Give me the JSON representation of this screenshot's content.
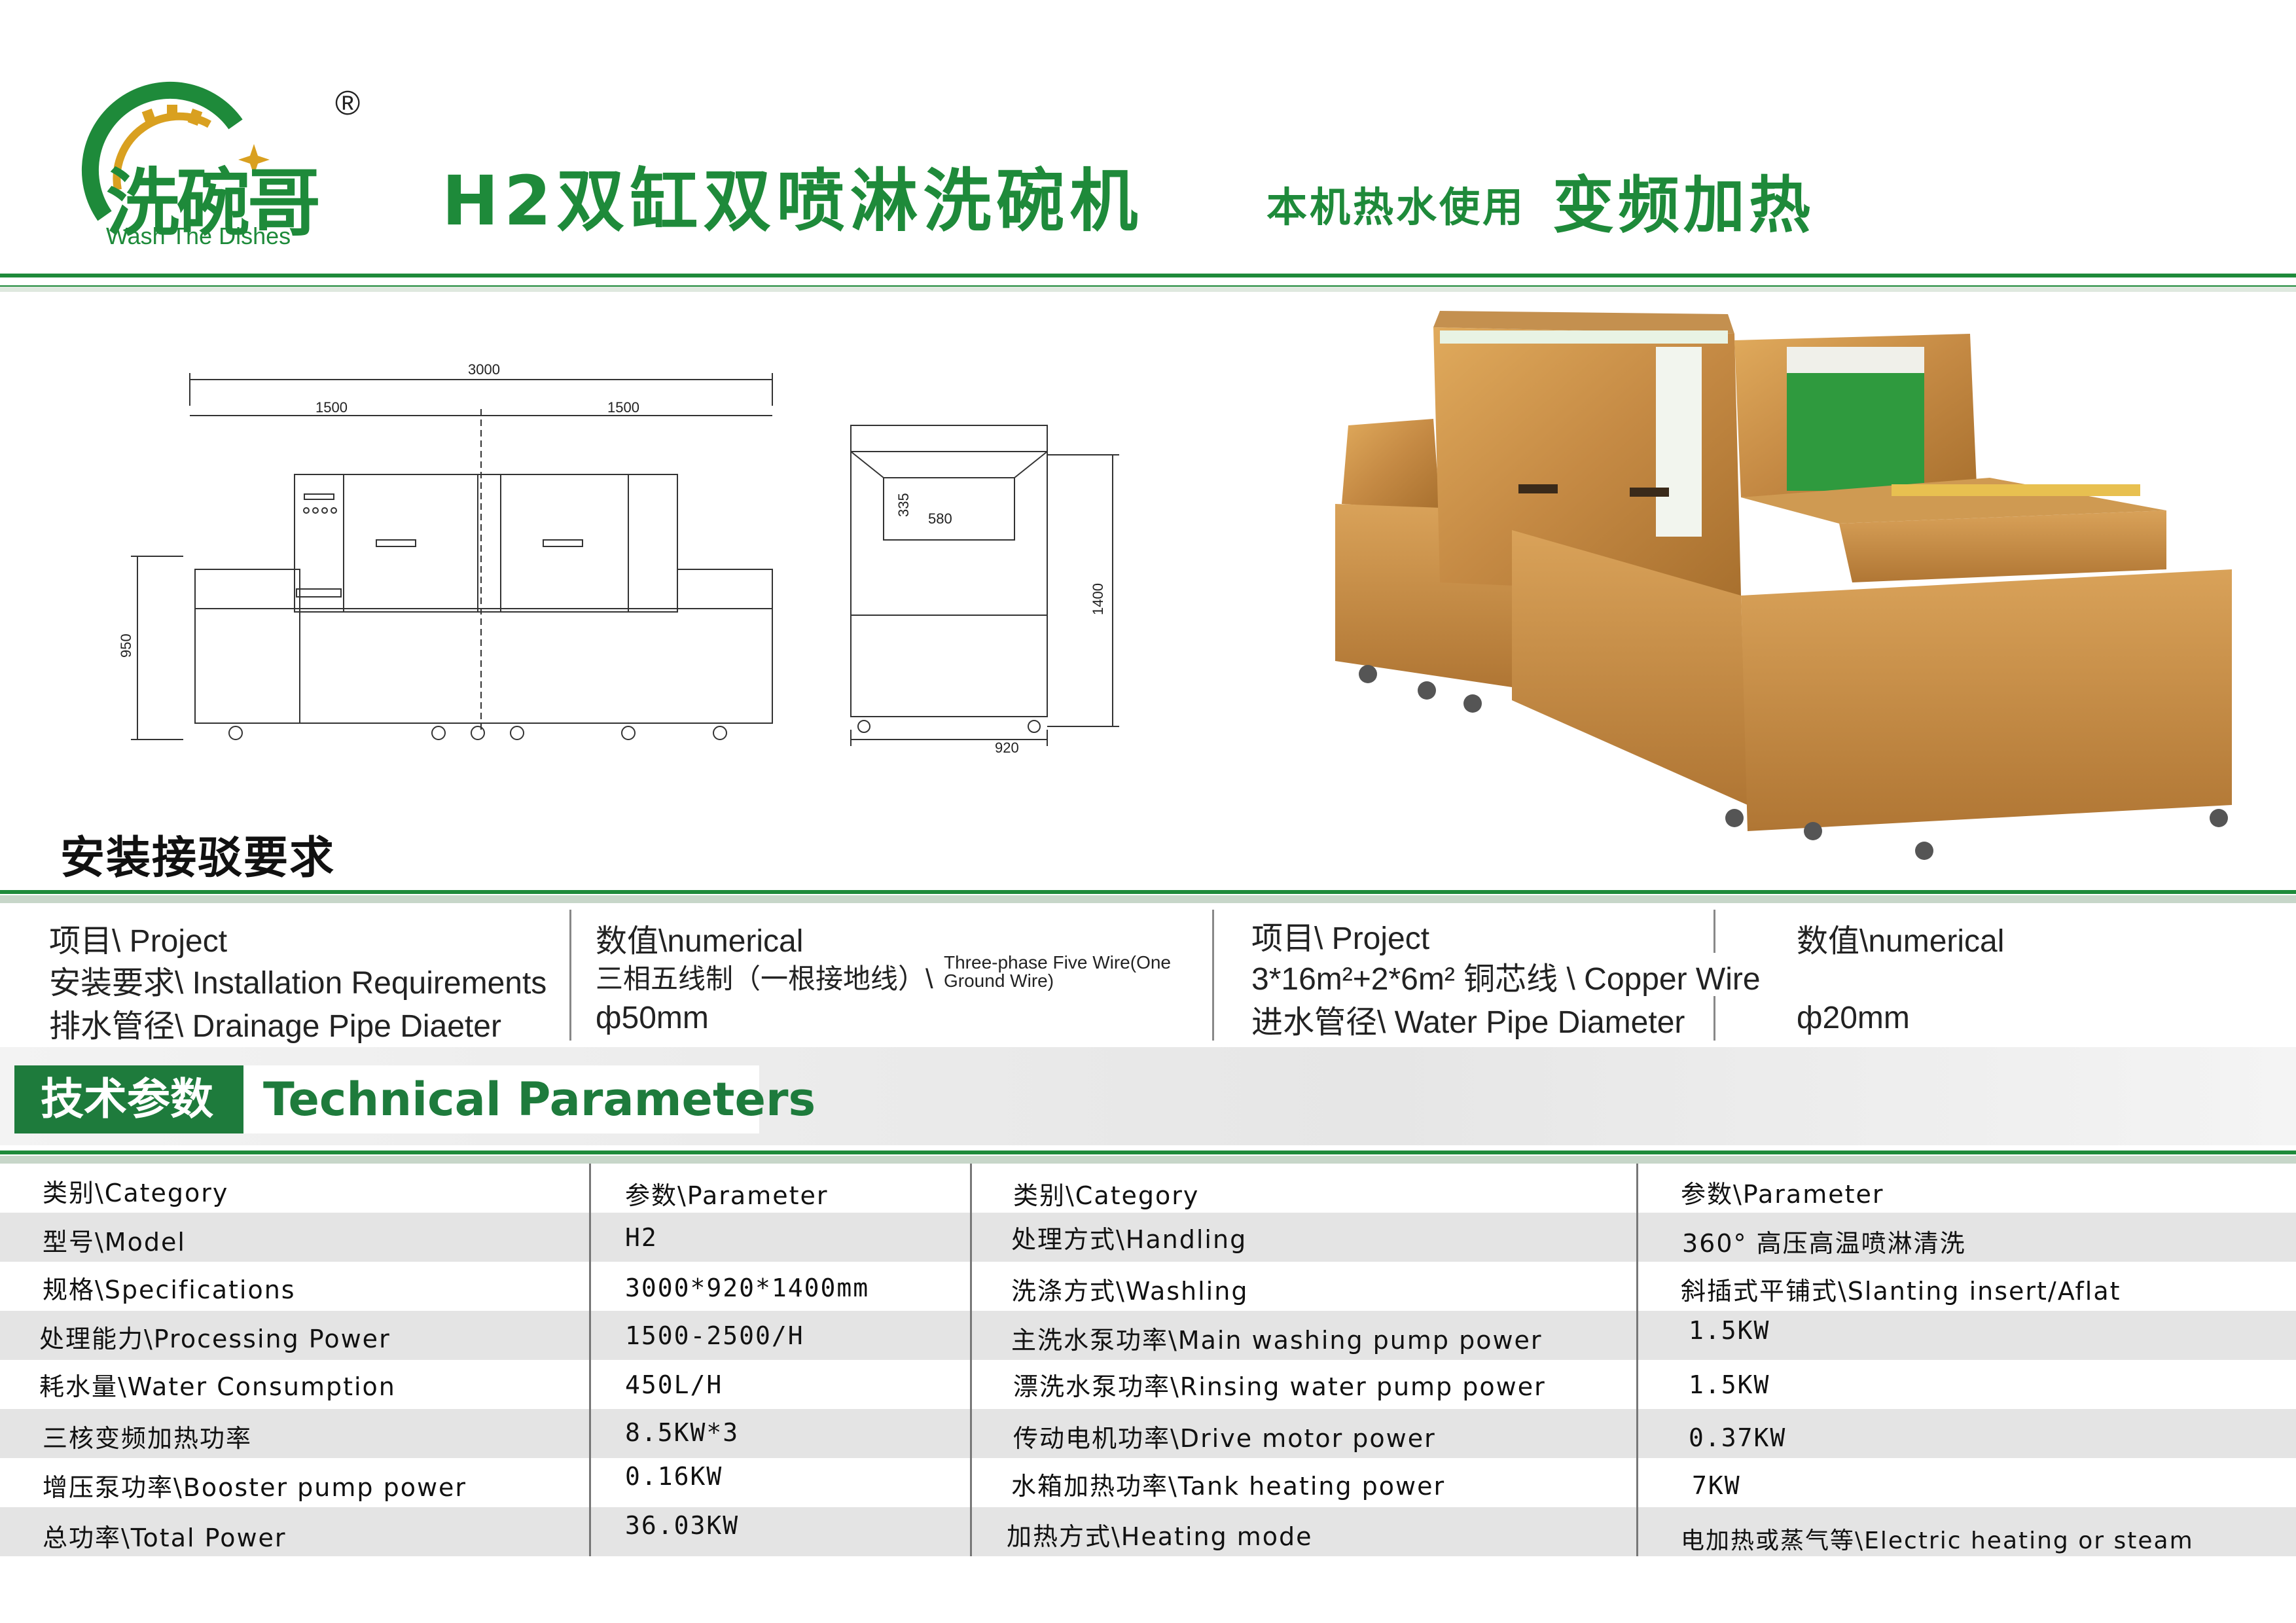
{
  "brand": {
    "logo_cn": "洗碗哥",
    "logo_en": "Wash The Dishes",
    "registered": "®"
  },
  "title": {
    "main": "H2双缸双喷淋洗碗机",
    "small": "本机热水使用",
    "big2": "变频加热"
  },
  "drawing": {
    "total_width": "3000",
    "left_width": "1500",
    "right_width": "1500",
    "height": "950",
    "side_height": "1400",
    "side_depth": "920",
    "opening_height": "335",
    "opening_width": "580"
  },
  "install": {
    "title": "安装接驳要求",
    "header": {
      "left_project": "项目\\ Project",
      "left_value": "数值\\numerical",
      "right_project": "项目\\ Project",
      "right_value": "数值\\numerical"
    },
    "rows": [
      {
        "left_project": "安装要求\\ Installation Requirements",
        "left_value": "三相五线制（一根接地线）\\",
        "left_value_small_1": "Three-phase Five Wire(One",
        "left_value_small_2": "Ground Wire)",
        "right_project": "3*16m²+2*6m² 铜芯线 \\ Copper Wire",
        "right_value": ""
      },
      {
        "left_project": "排水管径\\ Drainage Pipe Diaeter",
        "left_value": "ф50mm",
        "right_project": "进水管径\\ Water Pipe Diameter",
        "right_value": "ф20mm"
      }
    ]
  },
  "tech": {
    "title_cn": "技术参数",
    "title_en": "Technical Parameters",
    "header": {
      "c1": "类别\\Category",
      "c2": "参数\\Parameter",
      "c3": "类别\\Category",
      "c4": "参数\\Parameter"
    },
    "rows": [
      {
        "c1": "型号\\Model",
        "c2": "H2",
        "c3": "处理方式\\Handling",
        "c4": "360° 高压高温喷淋清洗"
      },
      {
        "c1": "规格\\Specifications",
        "c2": "3000*920*1400mm",
        "c3": "洗涤方式\\Washling",
        "c4": "斜插式平铺式\\Slanting insert/Aflat"
      },
      {
        "c1": "处理能力\\Processing Power",
        "c2": "1500-2500/H",
        "c3": "主洗水泵功率\\Main washing pump power",
        "c4": "1.5KW"
      },
      {
        "c1": "耗水量\\Water Consumption",
        "c2": "450L/H",
        "c3": "漂洗水泵功率\\Rinsing water pump power",
        "c4": "1.5KW"
      },
      {
        "c1": "三核变频加热功率",
        "c2": "8.5KW*3",
        "c3": "传动电机功率\\Drive motor power",
        "c4": "0.37KW"
      },
      {
        "c1": "增压泵功率\\Booster pump power",
        "c2": "0.16KW",
        "c3": "水箱加热功率\\Tank heating power",
        "c4": "7KW"
      },
      {
        "c1": "总功率\\Total Power",
        "c2": "36.03KW",
        "c3": "加热方式\\Heating mode",
        "c4": "电加热或蒸气等\\Electric heating or steam"
      }
    ]
  },
  "colors": {
    "brand_green": "#1e8a3a",
    "tech_green": "#1e7b3c",
    "machine_gold": "#c8914a"
  }
}
